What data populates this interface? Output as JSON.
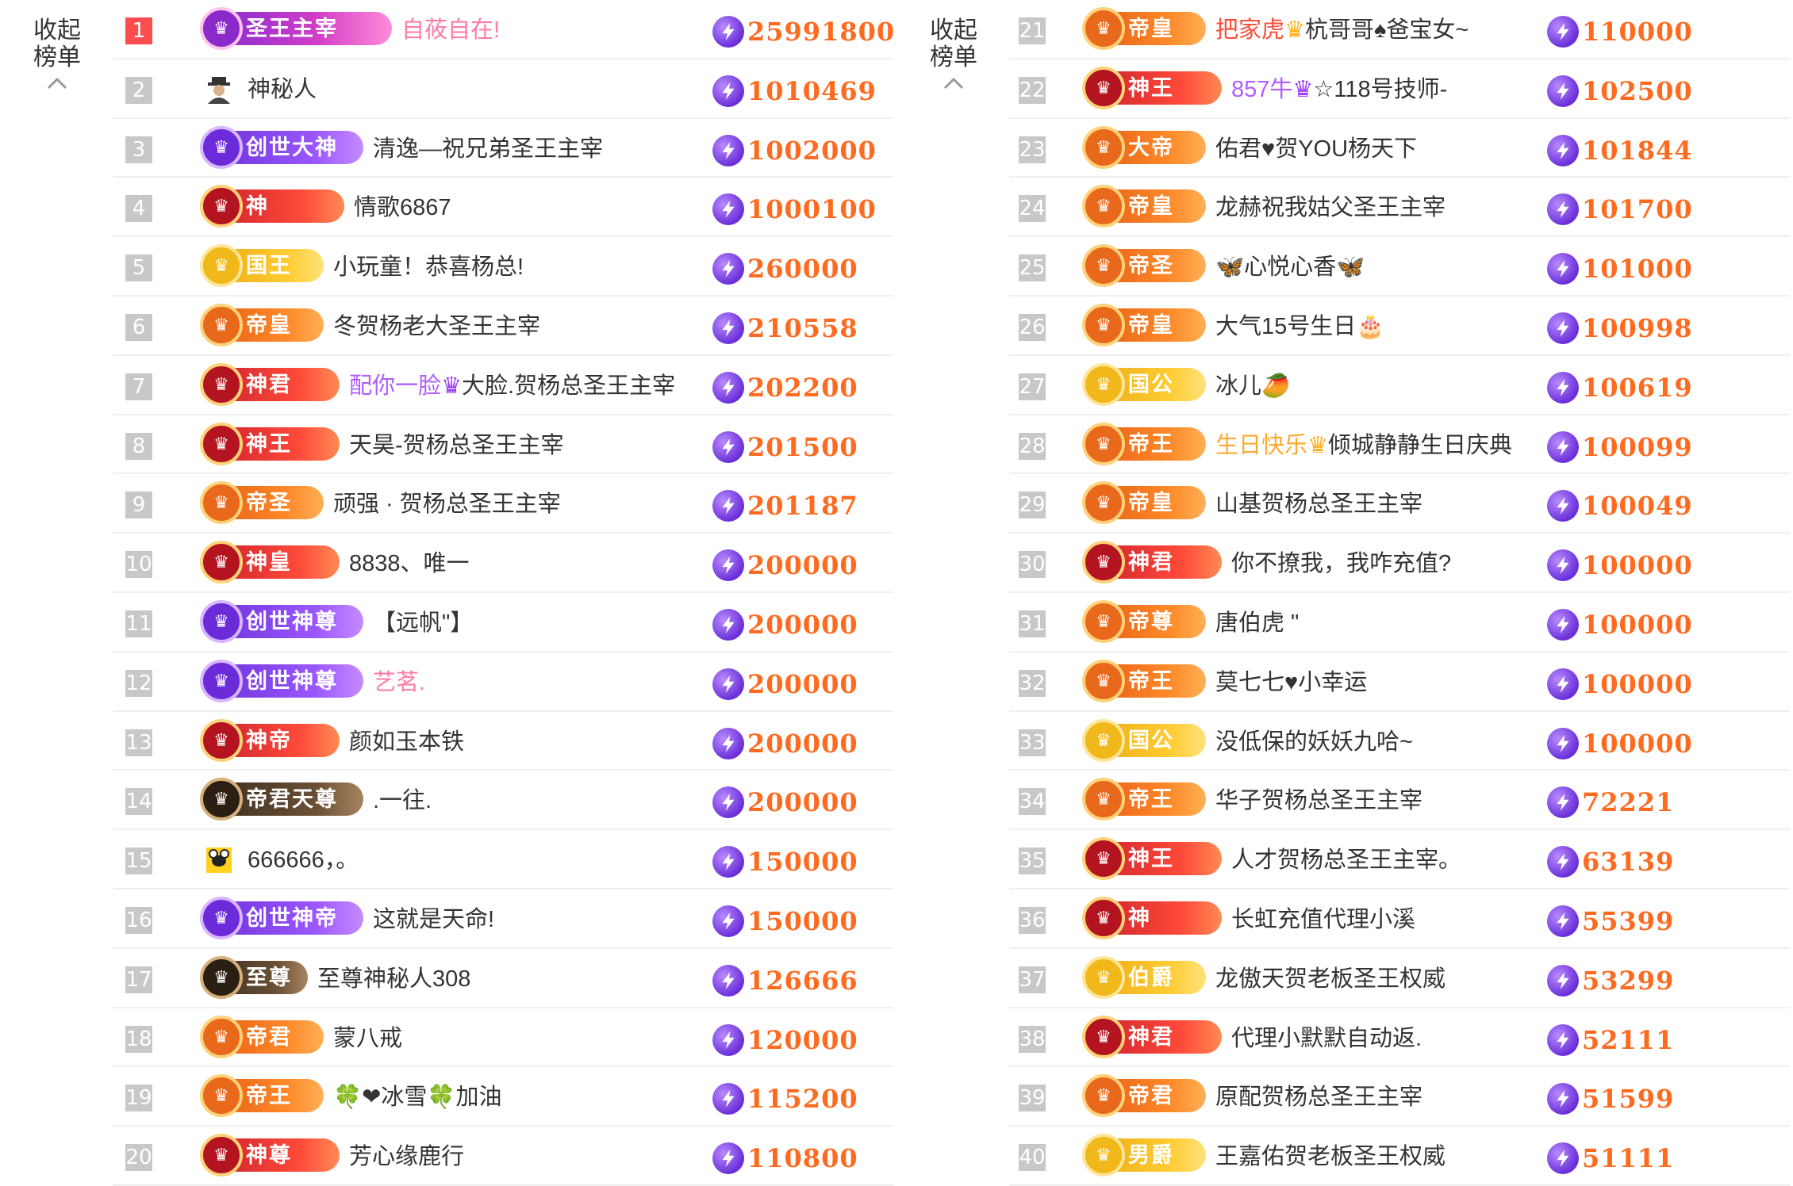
{
  "collapse": {
    "line1": "收起",
    "line2": "榜单"
  },
  "left_rows": [
    {
      "rank": "1",
      "badge": "圣王主宰",
      "style": "b-pink",
      "name": "自莜自在!",
      "name_color": "pink",
      "score": "25991800",
      "badge_w": 236
    },
    {
      "rank": "2",
      "avatar": "mystery-icon",
      "name": "神秘人",
      "score": "1010469"
    },
    {
      "rank": "3",
      "badge": "创世大神",
      "style": "b-purple",
      "name": "清逸—祝兄弟圣王主宰",
      "score": "1002000",
      "badge_w": 200
    },
    {
      "rank": "4",
      "badge": "神",
      "style": "b-red",
      "name": "情歌6867",
      "score": "1000100",
      "badge_w": 176
    },
    {
      "rank": "5",
      "badge": "国王",
      "style": "b-gold",
      "name": "小玩童！恭喜杨总!",
      "score": "260000",
      "badge_w": 150
    },
    {
      "rank": "6",
      "badge": "帝皇",
      "style": "b-orange",
      "name": "冬贺杨老大圣王主宰",
      "score": "210558",
      "badge_w": 150
    },
    {
      "rank": "7",
      "badge": "神君",
      "style": "b-red",
      "name": "配你一脸",
      "name_color": "purple",
      "name2": "大脸.贺杨总圣王主宰",
      "score": "202200",
      "badge_w": 170
    },
    {
      "rank": "8",
      "badge": "神王",
      "style": "b-red",
      "name": "天昊-贺杨总圣王主宰",
      "score": "201500",
      "badge_w": 170
    },
    {
      "rank": "9",
      "badge": "帝圣",
      "style": "b-orange",
      "name": "顽强 · 贺杨总圣王主宰",
      "score": "201187",
      "badge_w": 150
    },
    {
      "rank": "10",
      "badge": "神皇",
      "style": "b-red",
      "name": "8838、唯一",
      "score": "200000",
      "badge_w": 170
    },
    {
      "rank": "11",
      "badge": "创世神尊",
      "style": "b-purple",
      "name": "【远帆\"】",
      "score": "200000",
      "badge_w": 200
    },
    {
      "rank": "12",
      "badge": "创世神尊",
      "style": "b-purple",
      "name": "艺茗.",
      "name_color": "pink",
      "score": "200000",
      "badge_w": 200
    },
    {
      "rank": "13",
      "badge": "神帝",
      "style": "b-red",
      "name": "颜如玉本铁",
      "score": "200000",
      "badge_w": 170
    },
    {
      "rank": "14",
      "badge": "帝君天尊",
      "style": "b-dark",
      "name": ".一往.",
      "score": "200000",
      "badge_w": 200
    },
    {
      "rank": "15",
      "avatar": "bee-icon",
      "name": "666666，。",
      "score": "150000"
    },
    {
      "rank": "16",
      "badge": "创世神帝",
      "style": "b-purple",
      "name": "这就是天命!",
      "score": "150000",
      "badge_w": 200
    },
    {
      "rank": "17",
      "badge": "至尊",
      "style": "b-dark",
      "name": "至尊神秘人308",
      "score": "126666",
      "badge_w": 130
    },
    {
      "rank": "18",
      "badge": "帝君",
      "style": "b-orange",
      "name": "蒙八戒",
      "score": "120000",
      "badge_w": 150
    },
    {
      "rank": "19",
      "badge": "帝王",
      "style": "b-orange",
      "name": "🍀❤冰雪🍀加油",
      "score": "115200",
      "badge_w": 150
    },
    {
      "rank": "20",
      "badge": "神尊",
      "style": "b-red",
      "name": "芳心缘鹿行",
      "score": "110800",
      "badge_w": 170
    }
  ],
  "right_rows": [
    {
      "rank": "21",
      "badge": "帝皇",
      "style": "b-orange",
      "name": "把家虎",
      "name_color": "red",
      "name2": "杭哥哥♠爸宝女~",
      "score": "110000",
      "badge_w": 150
    },
    {
      "rank": "22",
      "badge": "神王",
      "style": "b-red",
      "name": "857牛",
      "name_color": "purple",
      "name2": "☆118号技师-",
      "score": "102500",
      "badge_w": 170
    },
    {
      "rank": "23",
      "badge": "大帝",
      "style": "b-orange",
      "name": "佑君♥贺YOU杨天下",
      "score": "101844",
      "badge_w": 150
    },
    {
      "rank": "24",
      "badge": "帝皇",
      "style": "b-orange",
      "name": "龙赫祝我姑父圣王主宰",
      "score": "101700",
      "badge_w": 150
    },
    {
      "rank": "25",
      "badge": "帝圣",
      "style": "b-orange",
      "name": "🦋心悦心香🦋",
      "score": "101000",
      "badge_w": 150
    },
    {
      "rank": "26",
      "badge": "帝皇",
      "style": "b-orange",
      "name": "大气15号生日🎂",
      "score": "100998",
      "badge_w": 150
    },
    {
      "rank": "27",
      "badge": "国公",
      "style": "b-gold",
      "name": "冰儿🥭",
      "score": "100619",
      "badge_w": 150
    },
    {
      "rank": "28",
      "badge": "帝王",
      "style": "b-orange",
      "name": "生日快乐",
      "name_color": "orange",
      "name2": "倾城静静生日庆典",
      "score": "100099",
      "badge_w": 150
    },
    {
      "rank": "29",
      "badge": "帝皇",
      "style": "b-orange",
      "name": "山基贺杨总圣王主宰",
      "score": "100049",
      "badge_w": 150
    },
    {
      "rank": "30",
      "badge": "神君",
      "style": "b-red",
      "name": "你不撩我，我咋充值?",
      "score": "100000",
      "badge_w": 170
    },
    {
      "rank": "31",
      "badge": "帝尊",
      "style": "b-orange",
      "name": "唐伯虎 \"",
      "score": "100000",
      "badge_w": 150
    },
    {
      "rank": "32",
      "badge": "帝王",
      "style": "b-orange",
      "name": "莫七七♥小幸运",
      "score": "100000",
      "badge_w": 150
    },
    {
      "rank": "33",
      "badge": "国公",
      "style": "b-gold",
      "name": "没低保的妖妖九哈~",
      "score": "100000",
      "badge_w": 150
    },
    {
      "rank": "34",
      "badge": "帝王",
      "style": "b-orange",
      "name": "华子贺杨总圣王主宰",
      "score": "72221",
      "badge_w": 150
    },
    {
      "rank": "35",
      "badge": "神王",
      "style": "b-red",
      "name": "人才贺杨总圣王主宰。",
      "score": "63139",
      "badge_w": 170
    },
    {
      "rank": "36",
      "badge": "神",
      "style": "b-red",
      "name": "长虹充值代理小溪",
      "score": "55399",
      "badge_w": 170
    },
    {
      "rank": "37",
      "badge": "伯爵",
      "style": "b-gold",
      "name": "龙傲天贺老板圣王权威",
      "score": "53299",
      "badge_w": 150
    },
    {
      "rank": "38",
      "badge": "神君",
      "style": "b-red",
      "name": "代理小默默自动返.",
      "score": "52111",
      "badge_w": 170
    },
    {
      "rank": "39",
      "badge": "帝君",
      "style": "b-orange",
      "name": "原配贺杨总圣王主宰",
      "score": "51599",
      "badge_w": 150
    },
    {
      "rank": "40",
      "badge": "男爵",
      "style": "b-gold",
      "name": "王嘉佑贺老板圣王权威",
      "score": "51111",
      "badge_w": 150
    }
  ]
}
